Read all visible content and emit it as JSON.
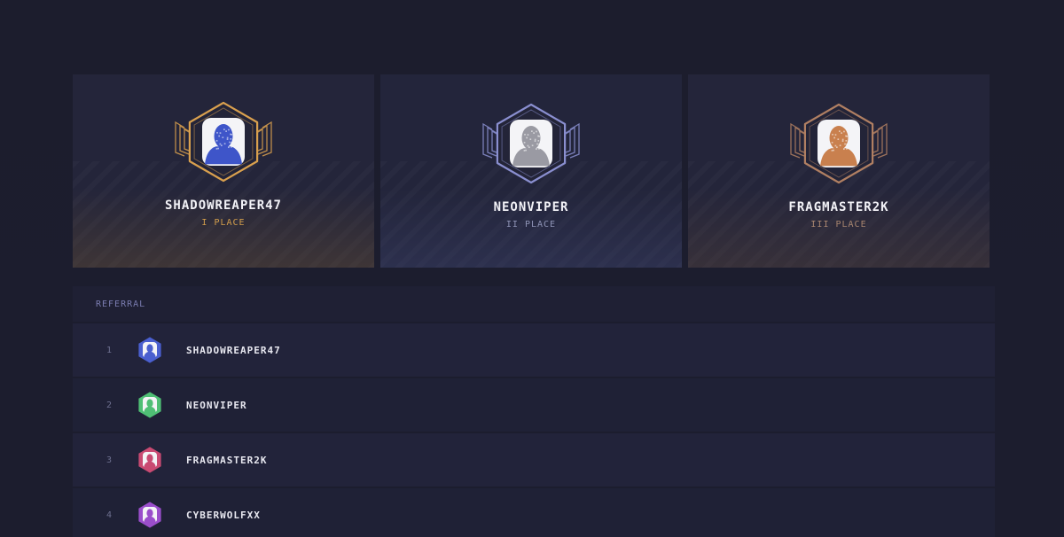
{
  "podium": [
    {
      "name": "SHADOWREAPER47",
      "place": "I PLACE",
      "tier": "gold",
      "accent": "#d9a04e",
      "avatar_color": "#3e55c9"
    },
    {
      "name": "NEONVIPER",
      "place": "II PLACE",
      "tier": "silver",
      "accent": "#8a8fd0",
      "avatar_color": "#9a9aa3"
    },
    {
      "name": "FRAGMASTER2K",
      "place": "III PLACE",
      "tier": "bronze",
      "accent": "#b07f62",
      "avatar_color": "#c9804e"
    }
  ],
  "table": {
    "header": "REFERRAL",
    "rows": [
      {
        "rank": "1",
        "name": "SHADOWREAPER47",
        "avatar_color": "#4a5fcf"
      },
      {
        "rank": "2",
        "name": "NEONVIPER",
        "avatar_color": "#4fbf75"
      },
      {
        "rank": "3",
        "name": "FRAGMASTER2K",
        "avatar_color": "#c94a72"
      },
      {
        "rank": "4",
        "name": "CYBERWOLFXX",
        "avatar_color": "#9a4ecb"
      }
    ]
  }
}
